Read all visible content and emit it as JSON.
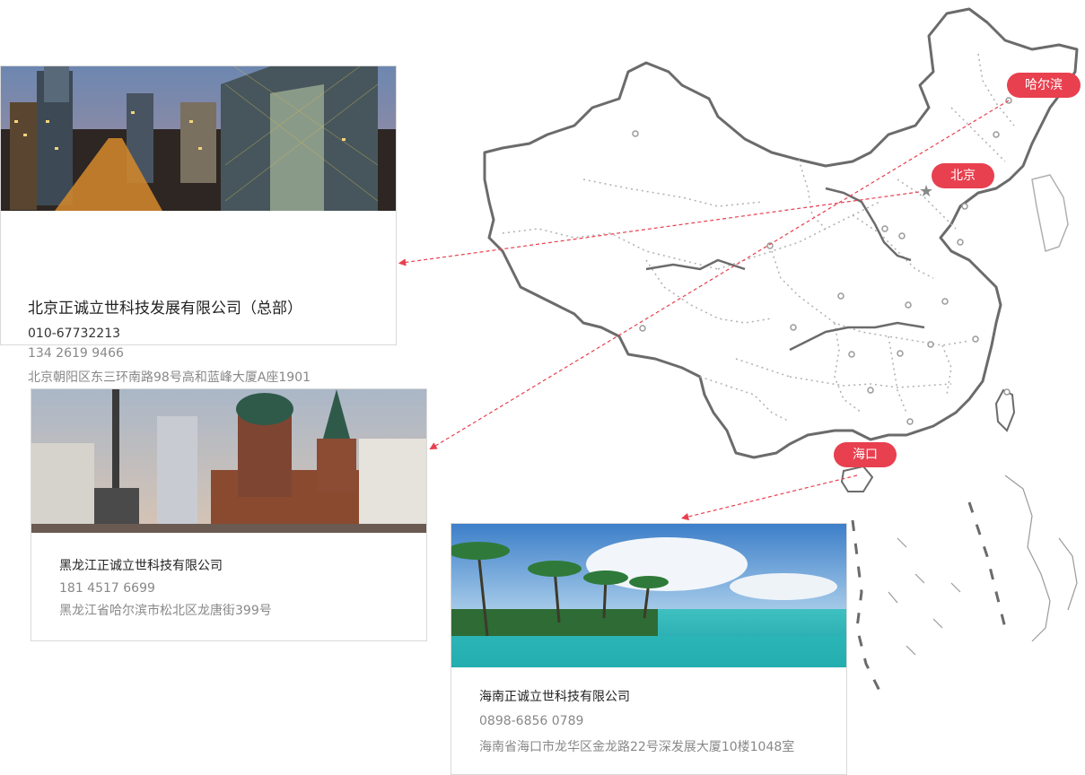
{
  "cities": {
    "harbin": "哈尔滨",
    "beijing": "北京",
    "haikou": "海口"
  },
  "offices": [
    {
      "name": "北京正诚立世科技发展有限公司（总部）",
      "phone": "010-67732213",
      "mobile": "134 2619 9466",
      "address": "北京朝阳区东三环南路98号高和蓝峰大厦A座1901"
    },
    {
      "name": "黑龙江正诚立世科技有限公司",
      "mobile": "181 4517 6699",
      "address": "黑龙江省哈尔滨市松北区龙唐街399号"
    },
    {
      "name": "海南正诚立世科技有限公司",
      "phone": "0898-6856 0789",
      "address": "海南省海口市龙华区金龙路22号深发展大厦10楼1048室"
    }
  ],
  "colors": {
    "accent": "#e8404f",
    "map_outline": "#6b6b6b",
    "map_dotted": "#b0b0b0"
  },
  "icons": {
    "capital": "star-icon",
    "city_marker": "dot-icon"
  }
}
